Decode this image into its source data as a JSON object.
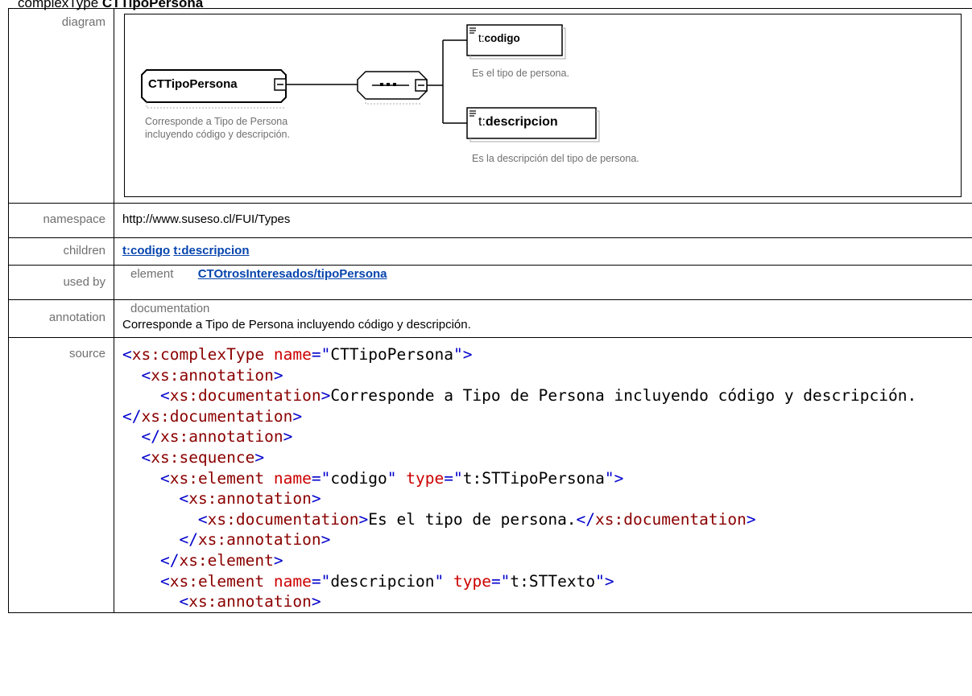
{
  "page_heading": {
    "prefix": "complexType",
    "name": "CTTipoPersona"
  },
  "rows": {
    "diagram_label": "diagram",
    "namespace_label": "namespace",
    "namespace_value": "http://www.suseso.cl/FUI/Types",
    "children_label": "children",
    "children": [
      "t:codigo",
      "t:descripcion"
    ],
    "used_by_label": "used by",
    "used_by_kind": "element",
    "used_by_value": "CTOtrosInteresados/tipoPersona",
    "annotation_label": "annotation",
    "annotation_kind": "documentation",
    "annotation_text": "Corresponde a Tipo de Persona incluyendo código y descripción.",
    "source_label": "source"
  },
  "diagram": {
    "type_name": "CTTipoPersona",
    "type_doc": "Corresponde a Tipo de Persona incluyendo código y descripción.",
    "child1_prefix": "t:",
    "child1_name": "codigo",
    "child1_doc": "Es el tipo de persona.",
    "child2_prefix": "t:",
    "child2_name": "descripcion",
    "child2_doc": "Es la descripción del tipo de persona."
  },
  "source": {
    "complexType_open_tag": "xs:complexType",
    "name_attr": "name",
    "type_name_value": "CTTipoPersona",
    "annotation_tag": "xs:annotation",
    "documentation_tag": "xs:documentation",
    "type_doc_text": "Corresponde a Tipo de Persona incluyendo código y descripción.",
    "sequence_tag": "xs:sequence",
    "element_tag": "xs:element",
    "type_attr": "type",
    "el1_name": "codigo",
    "el1_type": "t:STTipoPersona",
    "el1_doc": "Es el tipo de persona.",
    "el2_name": "descripcion",
    "el2_type": "t:STTexto"
  }
}
